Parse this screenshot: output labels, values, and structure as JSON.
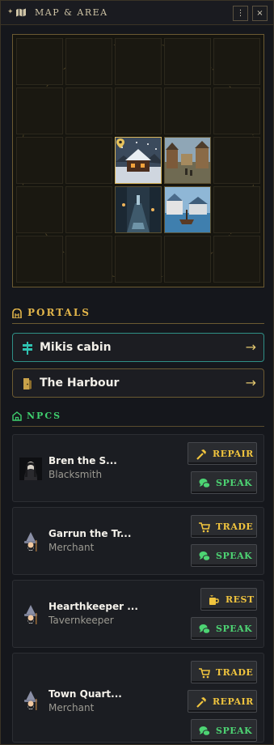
{
  "header": {
    "title": "MAP & AREA",
    "menu_label": "⋮",
    "close_label": "×"
  },
  "map": {
    "tiles": [
      {
        "name": "cabin",
        "row": 2,
        "col": 2,
        "active": true
      },
      {
        "name": "town-square",
        "row": 2,
        "col": 3,
        "active": false
      },
      {
        "name": "rainy-alley",
        "row": 3,
        "col": 2,
        "active": false
      },
      {
        "name": "harbour",
        "row": 3,
        "col": 3,
        "active": false
      }
    ]
  },
  "portals": {
    "title": "PORTALS",
    "items": [
      {
        "label": "Mikis cabin",
        "arrow": "→"
      },
      {
        "label": "The Harbour",
        "arrow": "→"
      }
    ]
  },
  "npcs": {
    "title": "NPCS",
    "items": [
      {
        "name": "Bren the S...",
        "role": "Blacksmith",
        "actions": [
          "REPAIR",
          "SPEAK"
        ]
      },
      {
        "name": "Garrun the Tr...",
        "role": "Merchant",
        "actions": [
          "TRADE",
          "SPEAK"
        ]
      },
      {
        "name": "Hearthkeeper ...",
        "role": "Tavernkeeper",
        "actions": [
          "REST",
          "SPEAK"
        ]
      },
      {
        "name": "Town Quart...",
        "role": "Merchant",
        "actions": [
          "TRADE",
          "REPAIR",
          "SPEAK"
        ]
      }
    ]
  },
  "colors": {
    "gold_accent": "#d7b45a",
    "teal_accent": "#2f9e95",
    "green_accent": "#4dd473",
    "yellow_action": "#f0c43e"
  }
}
